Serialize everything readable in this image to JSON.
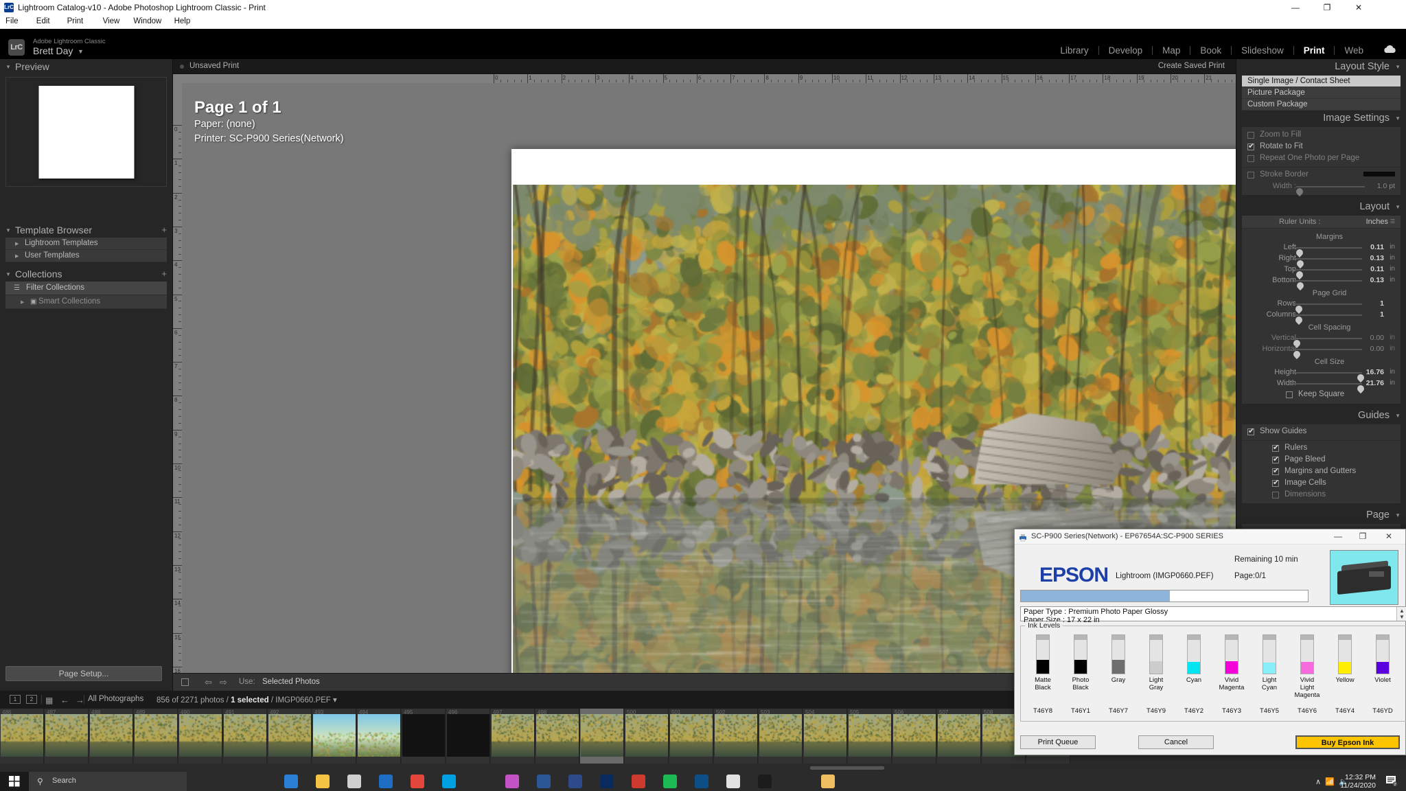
{
  "window": {
    "title": "Lightroom Catalog-v10 - Adobe Photoshop Lightroom Classic - Print",
    "icon": "LrC",
    "minimize": "—",
    "maximize": "❐",
    "close": "✕",
    "menu": [
      "File",
      "Edit",
      "Print",
      "View",
      "Window",
      "Help"
    ]
  },
  "identity": {
    "logo": "LrC",
    "app_name": "Adobe Lightroom Classic",
    "user": "Brett Day",
    "caret": "▼"
  },
  "modules": [
    {
      "label": "Library",
      "active": false
    },
    {
      "label": "Develop",
      "active": false
    },
    {
      "label": "Map",
      "active": false
    },
    {
      "label": "Book",
      "active": false
    },
    {
      "label": "Slideshow",
      "active": false
    },
    {
      "label": "Print",
      "active": true
    },
    {
      "label": "Web",
      "active": false
    }
  ],
  "left_panel": {
    "preview": {
      "title": "Preview",
      "triangle": "▼"
    },
    "template_browser": {
      "title": "Template Browser",
      "plus": "+",
      "triangle": "▼",
      "items": [
        {
          "label": "Lightroom Templates",
          "arrow": "▶"
        },
        {
          "label": "User Templates",
          "arrow": "▶"
        }
      ]
    },
    "collections": {
      "title": "Collections",
      "plus": "+",
      "triangle": "▼",
      "items": [
        {
          "label": "Filter Collections",
          "icon": "filter-icon",
          "selected": true
        },
        {
          "label": "Smart Collections",
          "icon": "smart-collection-icon",
          "arrow": "▶",
          "selected": false
        }
      ]
    },
    "page_setup_button": "Page Setup..."
  },
  "center": {
    "topstrip": {
      "left_label": "Unsaved Print",
      "right_label": "Create Saved Print"
    },
    "page_info": {
      "page": "Page 1 of 1",
      "paper_label": "Paper:",
      "paper_value": "(none)",
      "printer_label": "Printer:",
      "printer_value": "SC-P900 Series(Network)"
    },
    "toolbar": {
      "use_label": "Use:",
      "use_value": "Selected Photos",
      "dropdown": "≡",
      "prev_arrow": "⇦",
      "next_arrow": "⇨"
    }
  },
  "right_panel": {
    "layout_style": {
      "title": "Layout Style",
      "triangle": "▼",
      "options": [
        "Single Image / Contact Sheet",
        "Picture Package",
        "Custom Package"
      ],
      "selected": "Single Image / Contact Sheet"
    },
    "image_settings": {
      "title": "Image Settings",
      "triangle": "▼",
      "checks": [
        {
          "label": "Zoom to Fill",
          "checked": false,
          "enabled": false
        },
        {
          "label": "Rotate to Fit",
          "checked": true,
          "enabled": true
        },
        {
          "label": "Repeat One Photo per Page",
          "checked": false,
          "enabled": false
        },
        {
          "label": "Stroke Border",
          "checked": false,
          "enabled": false
        }
      ],
      "stroke_width_label": "Width :",
      "stroke_width_value": "1.0 pt",
      "stroke_color": "#0a0a0a"
    },
    "layout": {
      "title": "Layout",
      "triangle": "▼",
      "ruler_units_label": "Ruler Units :",
      "ruler_units_value": "Inches",
      "margins_label": "Margins",
      "margins": [
        {
          "name": "Left",
          "value": "0.11",
          "unit": "in",
          "pos": 4
        },
        {
          "name": "Right",
          "value": "0.13",
          "unit": "in",
          "pos": 5
        },
        {
          "name": "Top",
          "value": "0.11",
          "unit": "in",
          "pos": 4
        },
        {
          "name": "Bottom",
          "value": "0.13",
          "unit": "in",
          "pos": 5
        }
      ],
      "page_grid_label": "Page Grid",
      "page_grid": [
        {
          "name": "Rows",
          "value": "1",
          "unit": "",
          "pos": 3
        },
        {
          "name": "Columns",
          "value": "1",
          "unit": "",
          "pos": 3
        }
      ],
      "cell_spacing_label": "Cell Spacing",
      "cell_spacing": [
        {
          "name": "Vertical",
          "value": "0.00",
          "unit": "in",
          "pos": 0
        },
        {
          "name": "Horizontal",
          "value": "0.00",
          "unit": "in",
          "pos": 0
        }
      ],
      "cell_size_label": "Cell Size",
      "cell_size": [
        {
          "name": "Height",
          "value": "16.76",
          "unit": "in",
          "pos": 93
        },
        {
          "name": "Width",
          "value": "21.76",
          "unit": "in",
          "pos": 93
        }
      ],
      "keep_square": {
        "label": "Keep Square",
        "checked": false
      }
    },
    "guides": {
      "title": "Guides",
      "triangle": "▼",
      "show_guides": {
        "label": "Show Guides",
        "checked": true
      },
      "items": [
        {
          "label": "Rulers",
          "checked": true,
          "enabled": true
        },
        {
          "label": "Page Bleed",
          "checked": true,
          "enabled": true
        },
        {
          "label": "Margins and Gutters",
          "checked": true,
          "enabled": true
        },
        {
          "label": "Image Cells",
          "checked": true,
          "enabled": true
        },
        {
          "label": "Dimensions",
          "checked": false,
          "enabled": false
        }
      ]
    },
    "page": {
      "title": "Page",
      "triangle": "▼"
    }
  },
  "filmstrip": {
    "status": {
      "view1": "1",
      "view2": "2",
      "grid_icon": "grid-icon",
      "prev": "←",
      "next": "→",
      "source": "All Photographs",
      "count": "856 of 2271 photos / ",
      "selected": "1 selected",
      "filename": " / IMGP0660.PEF",
      "caret": "▾"
    },
    "start_number": 486,
    "selected_index": 13,
    "thumb_count": 24
  },
  "epson_dialog": {
    "title": "SC-P900 Series(Network) - EP67654A:SC-P900 SERIES",
    "minimize": "—",
    "maximize": "❐",
    "close": "✕",
    "brand": "EPSON",
    "job": "Lightroom (IMGP0660.PEF)",
    "remaining": "Remaining 10 min",
    "page": "Page:0/1",
    "progress_percent": 52,
    "progress_color": "#8fb4d9",
    "paper_type": "Paper Type : Premium Photo Paper Glossy",
    "paper_size": "Paper Size : 17 x 22 in",
    "ink_levels_label": "Ink Levels",
    "inks": [
      {
        "name": "Matte\nBlack",
        "code": "T46Y8",
        "color": "#000000",
        "level": 36
      },
      {
        "name": "Photo\nBlack",
        "code": "T46Y1",
        "color": "#000000",
        "level": 36
      },
      {
        "name": "Gray",
        "code": "T46Y7",
        "color": "#6e6e6e",
        "level": 36
      },
      {
        "name": "Light\nGray",
        "code": "T46Y9",
        "color": "#cccccc",
        "level": 33
      },
      {
        "name": "Cyan",
        "code": "T46Y2",
        "color": "#00e5f0",
        "level": 30
      },
      {
        "name": "Vivid\nMagenta",
        "code": "T46Y3",
        "color": "#f400d8",
        "level": 33
      },
      {
        "name": "Light\nCyan",
        "code": "T46Y5",
        "color": "#86eff7",
        "level": 29
      },
      {
        "name": "Vivid\nLight\nMagenta",
        "code": "T46Y6",
        "color": "#f76bdf",
        "level": 31
      },
      {
        "name": "Yellow",
        "code": "T46Y4",
        "color": "#ffee00",
        "level": 31
      },
      {
        "name": "Violet",
        "code": "T46YD",
        "color": "#5a00e0",
        "level": 31
      }
    ],
    "buttons": {
      "print_queue": "Print Queue",
      "cancel": "Cancel",
      "buy_ink": "Buy Epson Ink"
    }
  },
  "taskbar": {
    "start_icon": "windows-icon",
    "search_placeholder": "Search",
    "search_icon": "search-icon",
    "clock_time": "12:32 PM",
    "clock_date": "11/24/2020",
    "tray": {
      "chevron": "∧",
      "wifi": "◠",
      "volume": "◂))",
      "notifications": "2"
    },
    "apps": [
      {
        "name": "task-view-icon",
        "color": "#2b2b2b"
      },
      {
        "name": "cortana-icon",
        "color": "#2b2b2b"
      },
      {
        "name": "photos-icon",
        "color": "#2b7fd4"
      },
      {
        "name": "explorer-icon",
        "color": "#f6c445"
      },
      {
        "name": "store-icon",
        "color": "#d0d0d0"
      },
      {
        "name": "mail-icon",
        "color": "#1e6fc4"
      },
      {
        "name": "chrome-icon",
        "color": "#e5463b"
      },
      {
        "name": "skype-icon",
        "color": "#00a0e4"
      },
      {
        "name": "epic-icon",
        "color": "#2a2a2a"
      },
      {
        "name": "itunes-icon",
        "color": "#c453c8"
      },
      {
        "name": "word-icon",
        "color": "#2b5797"
      },
      {
        "name": "lightroom-icon",
        "color": "#2d4a8a"
      },
      {
        "name": "photoshop-icon",
        "color": "#0a2a5e"
      },
      {
        "name": "acrobat-icon",
        "color": "#cf3a2e"
      },
      {
        "name": "spotify-icon",
        "color": "#1db954"
      },
      {
        "name": "nextcloud-icon",
        "color": "#0b4f86"
      },
      {
        "name": "luminar-icon",
        "color": "#e2e2e2"
      },
      {
        "name": "capture-icon",
        "color": "#1c1c1c"
      },
      {
        "name": "terminal-icon",
        "color": "#2b2b2b"
      },
      {
        "name": "folder-icon",
        "color": "#f0c060"
      }
    ]
  }
}
